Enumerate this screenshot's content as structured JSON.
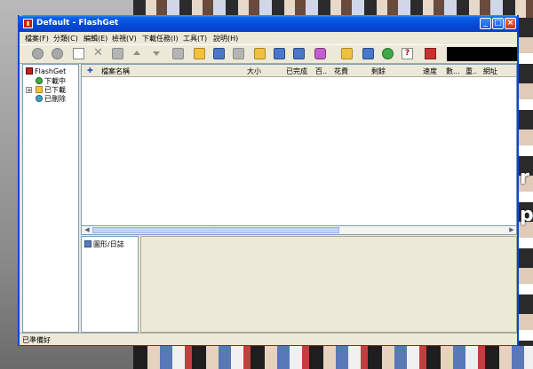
{
  "window": {
    "title": "Default - FlashGet"
  },
  "menu": [
    "檔案(F)",
    "分類(C)",
    "編輯(E)",
    "檢視(V)",
    "下載任務(I)",
    "工具(T)",
    "說明(H)"
  ],
  "tree": {
    "root": "FlashGet",
    "items": [
      "下載中",
      "已下載",
      "已刪除"
    ]
  },
  "list": {
    "columns": [
      "檔案名稱",
      "大小",
      "已完成",
      "百..",
      "花費",
      "剩餘",
      "速度",
      "數...",
      "重..",
      "網址"
    ]
  },
  "graph_panel": {
    "label": "圖形/日誌"
  },
  "status": {
    "text": "已準備好"
  },
  "titlebar_buttons": {
    "minimize": "_",
    "maximize": "□",
    "close": "×"
  },
  "scroll": {
    "left": "◀",
    "right": "▶",
    "grip": ":::"
  },
  "background": {
    "right_letters": [
      "r",
      "p"
    ]
  }
}
